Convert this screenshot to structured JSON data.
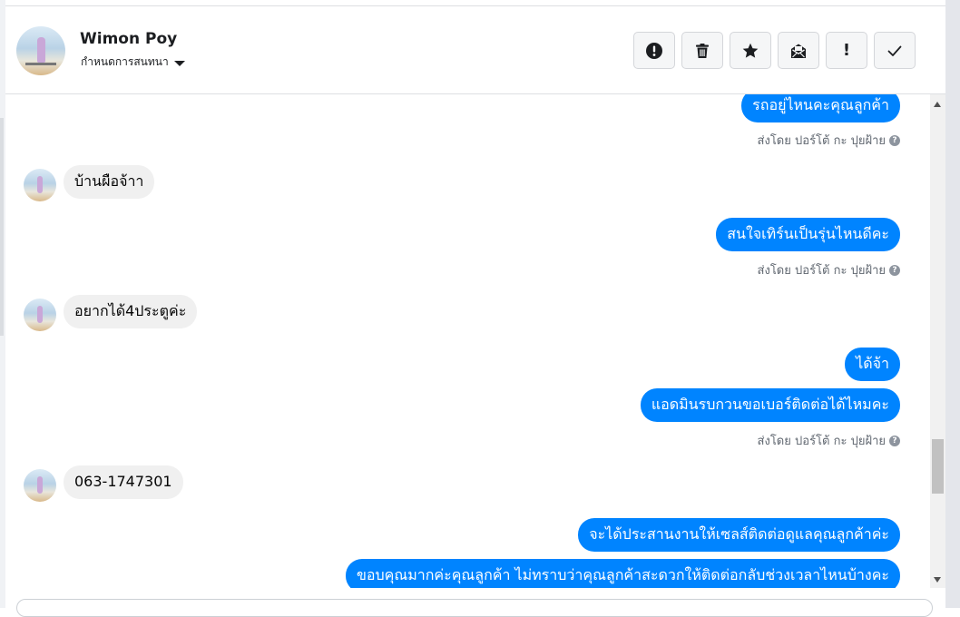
{
  "header": {
    "contact_name": "Wimon Poy",
    "assign_label": "กำหนดการสนทนา",
    "actions": [
      {
        "icon": "alert-circle-icon",
        "name": "mark-spam-button"
      },
      {
        "icon": "trash-icon",
        "name": "delete-button"
      },
      {
        "icon": "star-icon",
        "name": "star-button"
      },
      {
        "icon": "mark-unread-icon",
        "name": "mark-unread-button"
      },
      {
        "icon": "exclamation-icon",
        "name": "follow-up-button"
      },
      {
        "icon": "check-icon",
        "name": "mark-done-button"
      }
    ]
  },
  "messages": {
    "m1": "รถอยู่ไหนคะคุณลูกค้า",
    "s1": "ส่งโดย ปอร์โต้ กะ ปุยฝ้าย",
    "m2": "บ้านผือจ้าา",
    "m3": "สนใจเทิร์นเป็นรุ่นไหนดีคะ",
    "s2": "ส่งโดย ปอร์โต้ กะ ปุยฝ้าย",
    "m4": "อยากได้4ประตูค่ะ",
    "m5": "ได้จ้า",
    "m6": "แอดมินรบกวนขอเบอร์ติดต่อได้ไหมคะ",
    "s3": "ส่งโดย ปอร์โต้ กะ ปุยฝ้าย",
    "m7": "063-1747301",
    "m8": "จะได้ประสานงานให้เซลส์ติดต่อดูแลคุณลูกค้าค่ะ",
    "m9": "ขอบคุณมากค่ะคุณลูกค้า ไม่ทราบว่าคุณลูกค้าสะดวกให้ติดต่อกลับช่วงเวลาไหนบ้างคะ"
  },
  "help_glyph": "?",
  "colors": {
    "outgoing_bubble": "#0084ff",
    "incoming_bubble": "#f0f0f0"
  }
}
